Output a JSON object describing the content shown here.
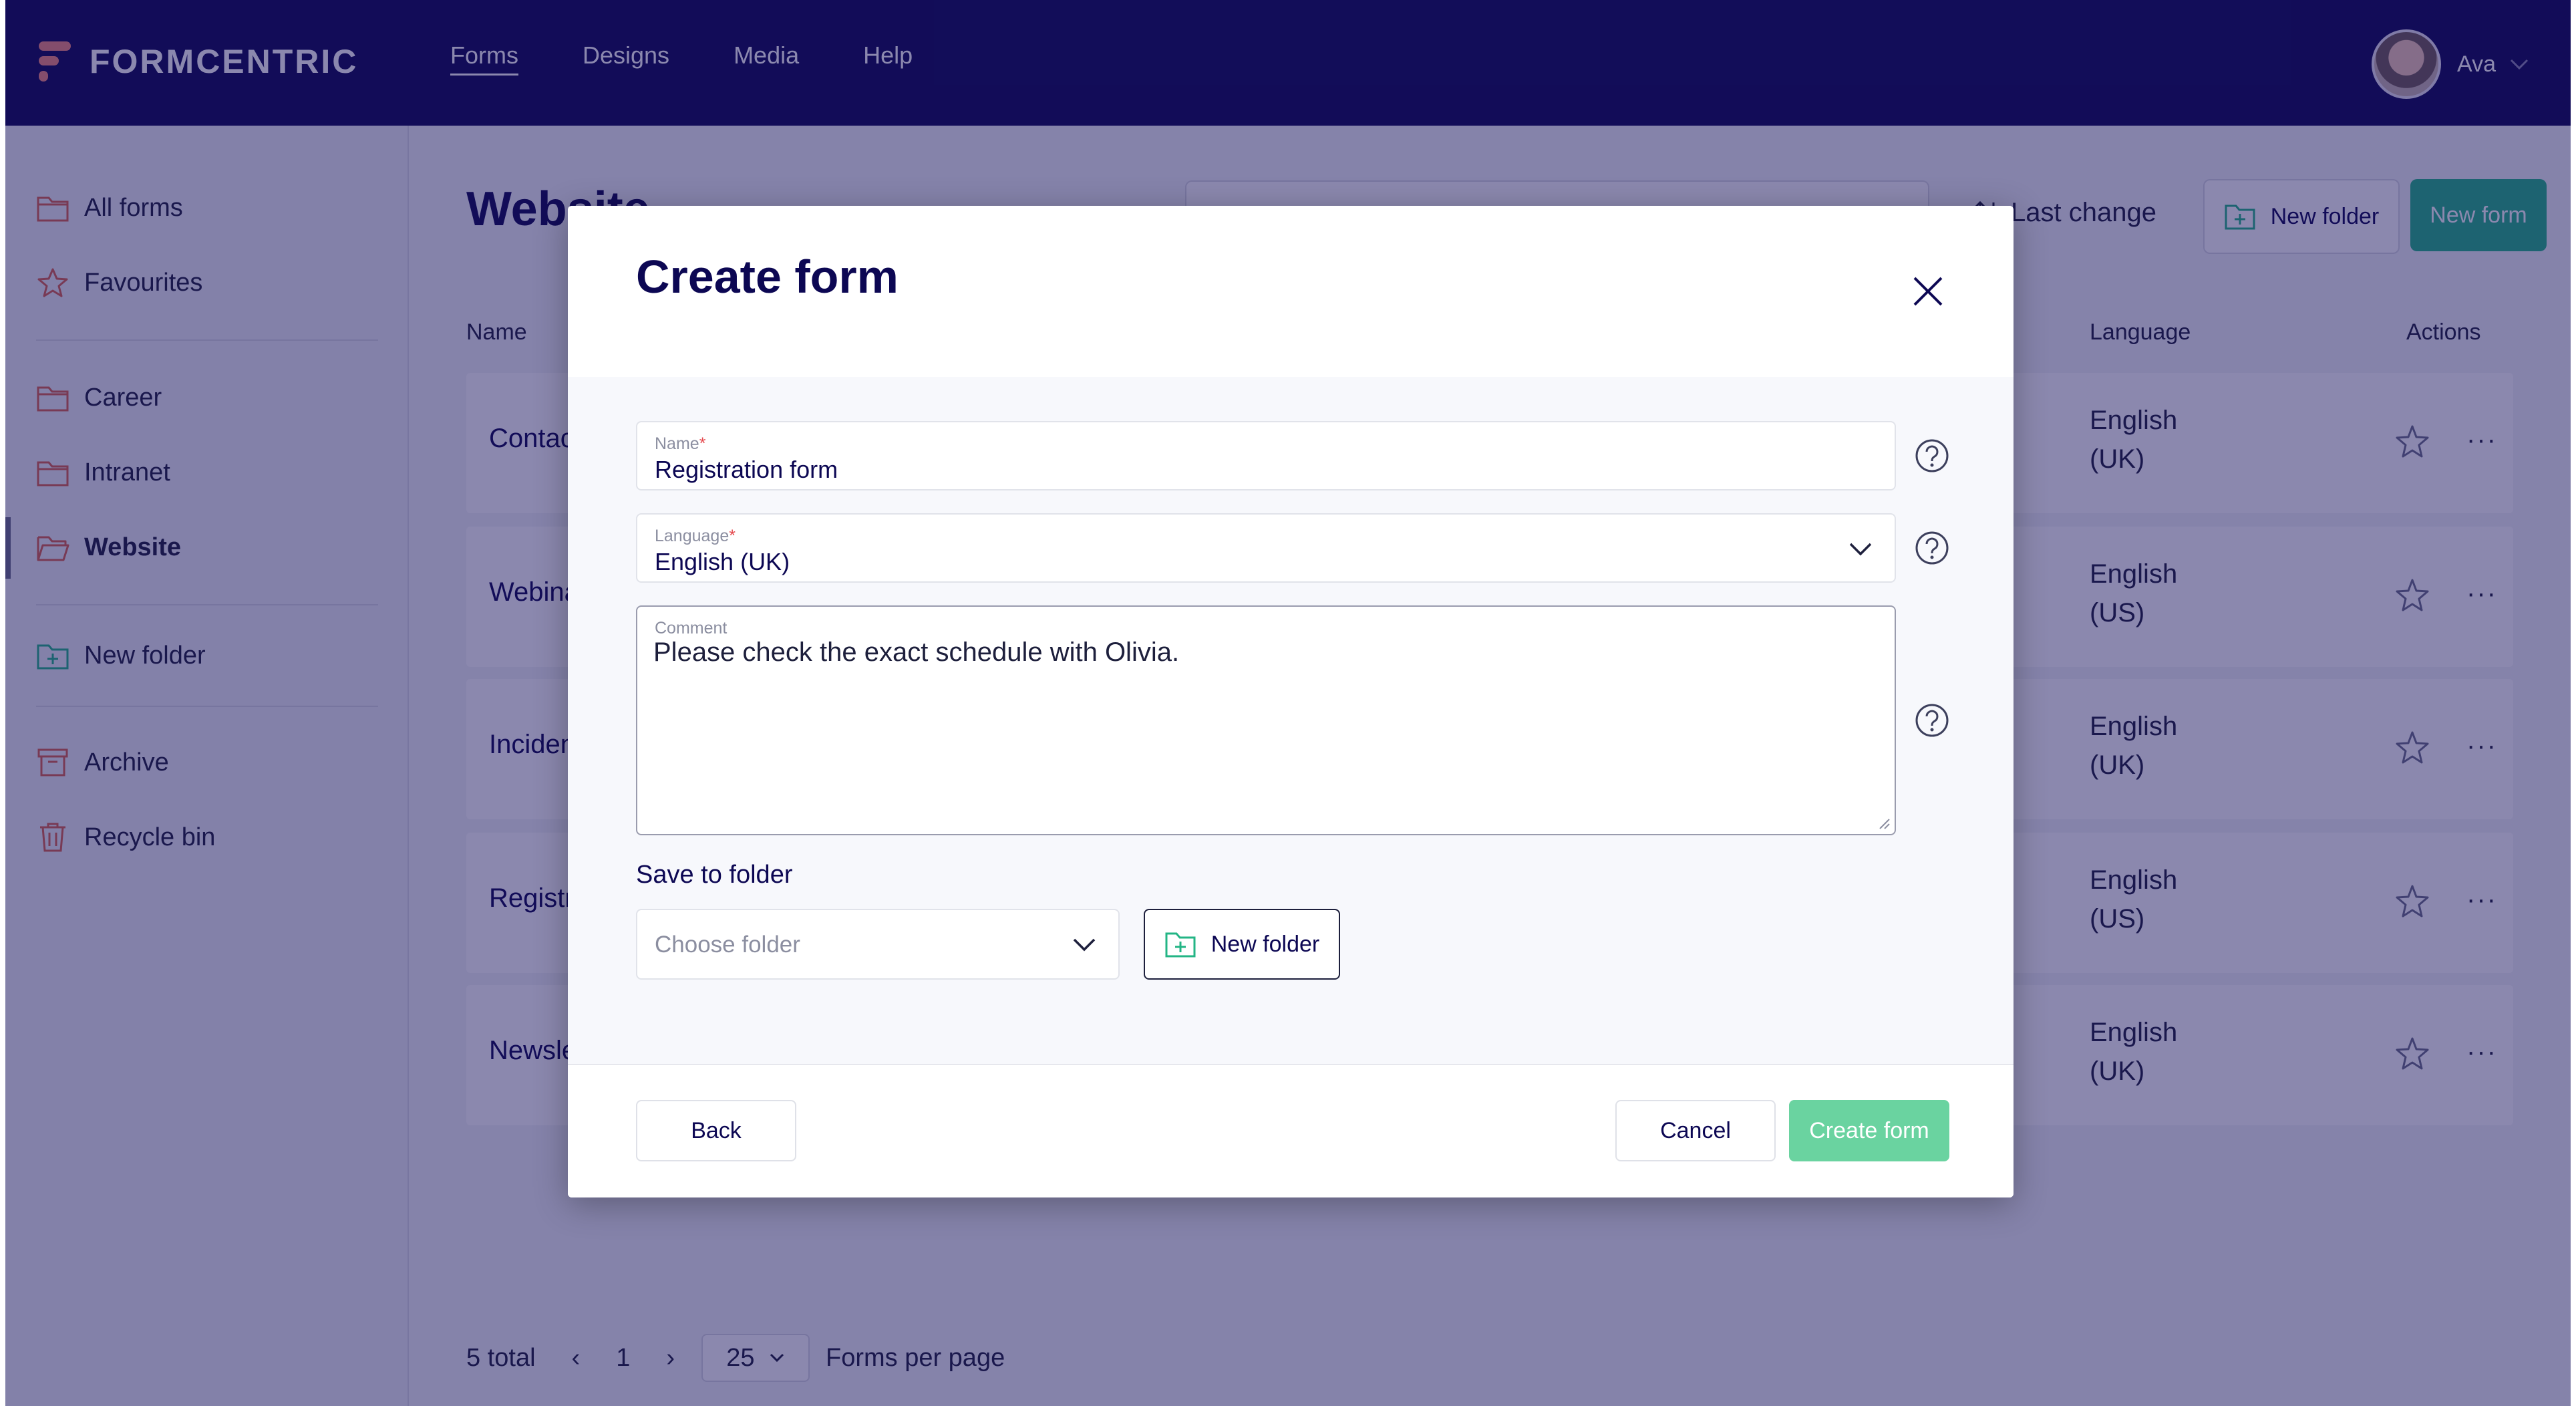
{
  "brand": {
    "name": "FORMCENTRIC"
  },
  "nav": {
    "items": [
      "Forms",
      "Designs",
      "Media",
      "Help"
    ],
    "active": "Forms"
  },
  "user": {
    "name": "Ava"
  },
  "sidebar": {
    "items": [
      {
        "label": "All forms",
        "icon": "folder-icon"
      },
      {
        "label": "Favourites",
        "icon": "star-icon"
      },
      {
        "label": "Career",
        "icon": "folder-icon"
      },
      {
        "label": "Intranet",
        "icon": "folder-icon"
      },
      {
        "label": "Website",
        "icon": "folder-open-icon",
        "active": true
      },
      {
        "label": "New folder",
        "icon": "folder-plus-icon"
      },
      {
        "label": "Archive",
        "icon": "archive-icon"
      },
      {
        "label": "Recycle bin",
        "icon": "trash-icon"
      }
    ],
    "collapse_glyph": "II"
  },
  "main": {
    "title": "Website",
    "sort_label": "Last change",
    "new_folder_label": "New folder",
    "new_form_label": "New form",
    "columns": {
      "name": "Name",
      "language": "Language",
      "actions": "Actions"
    },
    "rows": [
      {
        "name": "Contac",
        "language_line1": "English",
        "language_line2": "(UK)"
      },
      {
        "name": "Webina",
        "language_line1": "English",
        "language_line2": "(US)"
      },
      {
        "name": "Inciden",
        "language_line1": "English",
        "language_line2": "(UK)"
      },
      {
        "name": "Registr",
        "language_line1": "English",
        "language_line2": "(US)"
      },
      {
        "name": "Newsle",
        "language_line1": "English",
        "language_line2": "(UK)"
      }
    ],
    "more_glyph": "···",
    "footer": {
      "total": "5 total",
      "prev": "‹",
      "page": "1",
      "next": "›",
      "per_page": "25",
      "per_page_label": "Forms per page"
    }
  },
  "modal": {
    "title": "Create form",
    "name_label": "Name",
    "name_value": "Registration form",
    "language_label": "Language",
    "language_value": "English (UK)",
    "comment_label": "Comment",
    "comment_value": "Please check the exact schedule with Olivia.",
    "required_mark": "*",
    "save_to_folder_label": "Save to folder",
    "folder_placeholder": "Choose folder",
    "new_folder_label": "New folder",
    "back_label": "Back",
    "cancel_label": "Cancel",
    "create_label": "Create form"
  },
  "colors": {
    "nav_bg": "#0c0753",
    "accent_green": "#23b585",
    "create_button": "#6ad3a0",
    "logo_accent": "#f0897a",
    "sidebar_icon": "#d8634c"
  }
}
